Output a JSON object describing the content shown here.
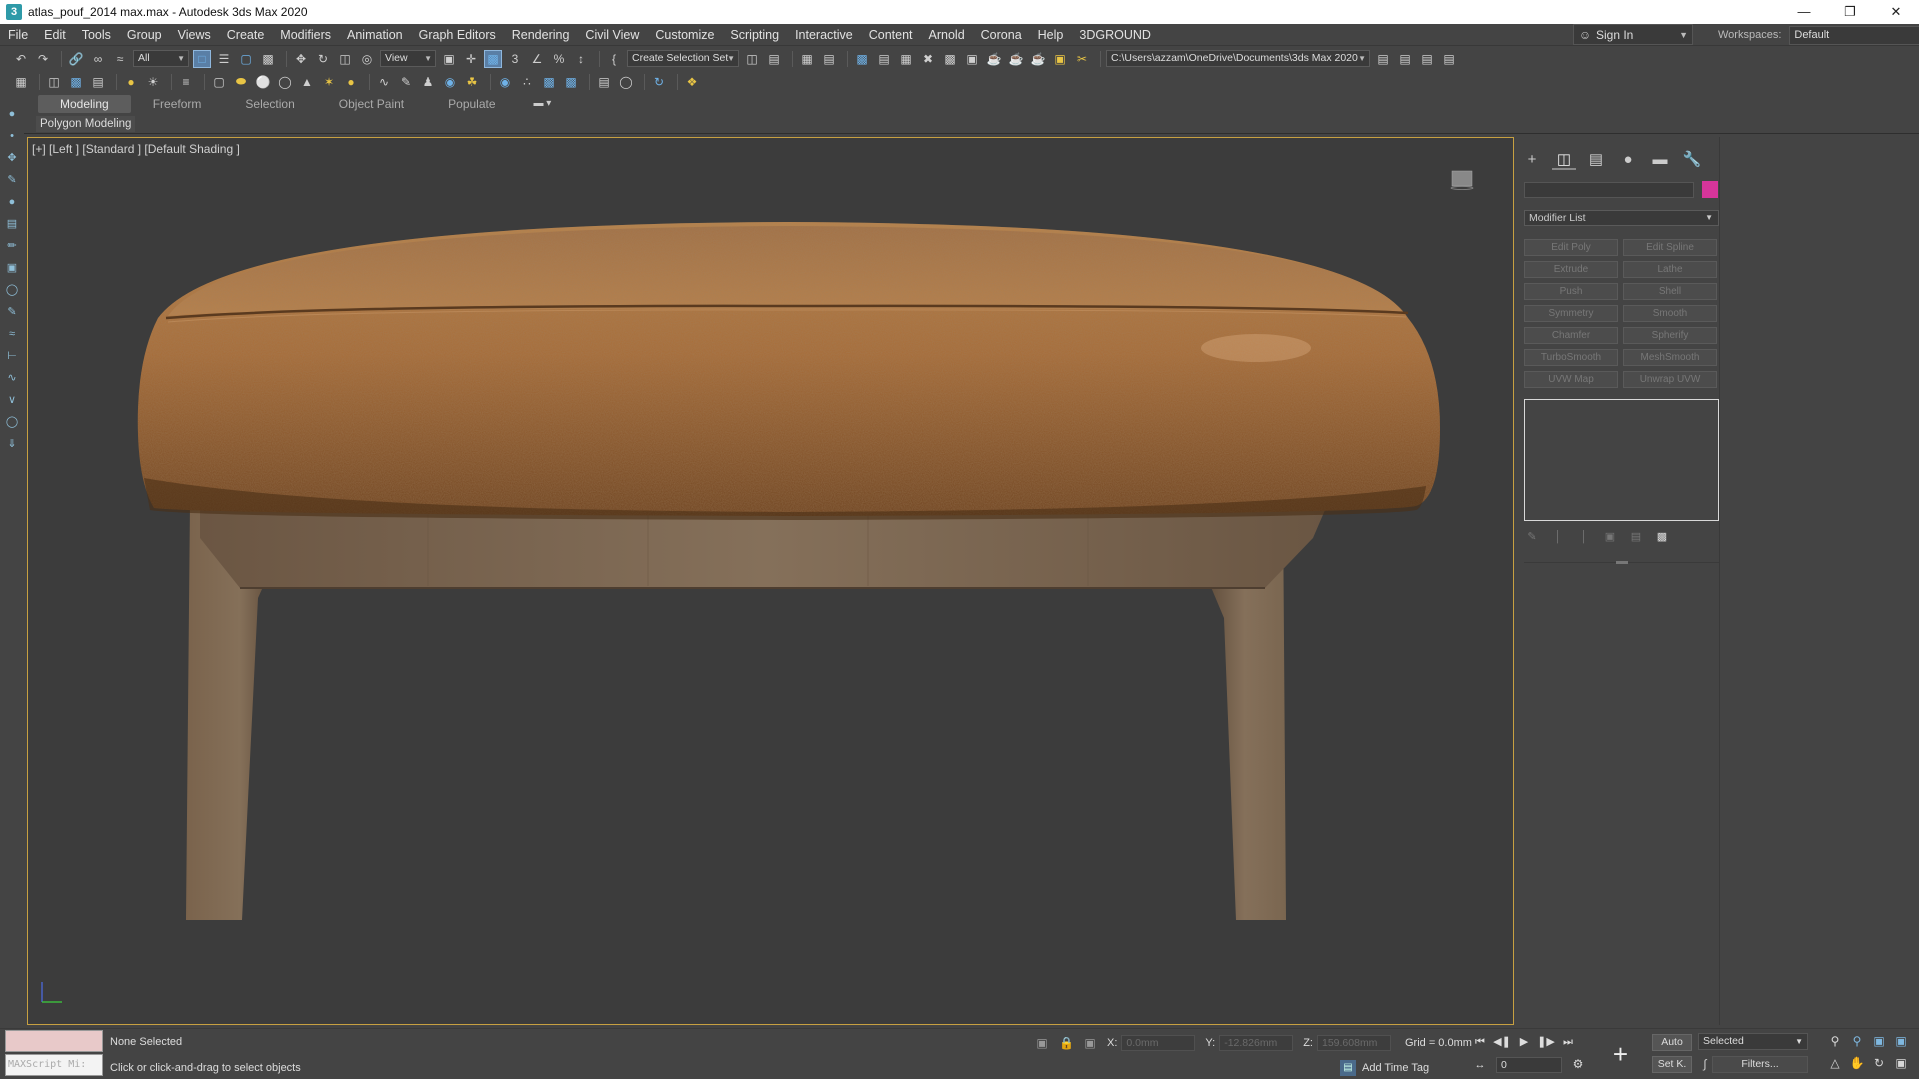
{
  "window": {
    "title": "atlas_pouf_2014 max.max - Autodesk 3ds Max 2020",
    "app_icon": "3",
    "min_glyph": "—",
    "max_glyph": "❐",
    "close_glyph": "✕"
  },
  "menu": [
    "File",
    "Edit",
    "Tools",
    "Group",
    "Views",
    "Create",
    "Modifiers",
    "Animation",
    "Graph Editors",
    "Rendering",
    "Civil View",
    "Customize",
    "Scripting",
    "Interactive",
    "Content",
    "Arnold",
    "Corona",
    "Help",
    "3DGROUND"
  ],
  "account": {
    "sign_in": "Sign In",
    "workspaces_label": "Workspaces:",
    "workspace": "Default"
  },
  "toolbar": {
    "filter": "All",
    "ref_coord": "View",
    "selection_set": "Create Selection Set",
    "project_path": "C:\\Users\\azzam\\OneDrive\\Documents\\3ds Max 2020",
    "snap_value": "3",
    "percent_glyph": "%"
  },
  "ribbon": {
    "tabs": [
      "Modeling",
      "Freeform",
      "Selection",
      "Object Paint",
      "Populate"
    ],
    "active_tab": "Modeling",
    "panel_label": "Polygon Modeling"
  },
  "viewport": {
    "label": "[+] [Left ] [Standard ] [Default Shading ]",
    "border_color": "#c7a041",
    "background": "#3c3c3c",
    "object": "pouf"
  },
  "command_panel": {
    "color_swatch": "#d6359a",
    "modifier_list": "Modifier List",
    "modifiers": [
      "Edit Poly",
      "Edit Spline",
      "Extrude",
      "Lathe",
      "Push",
      "Shell",
      "Symmetry",
      "Smooth",
      "Chamfer",
      "Spherify",
      "TurboSmooth",
      "MeshSmooth",
      "UVW Map",
      "Unwrap UVW"
    ]
  },
  "status": {
    "maxscript": "MAXScript Mi:",
    "selection": "None Selected",
    "prompt": "Click or click-and-drag to select objects",
    "x_label": "X:",
    "x_value": "0.0mm",
    "y_label": "Y:",
    "y_value": "-12.826mm",
    "z_label": "Z:",
    "z_value": "159.608mm",
    "grid": "Grid = 0.0mm",
    "add_time_tag": "Add Time Tag",
    "frame": "0",
    "auto_key": "Auto",
    "set_key": "Set K.",
    "key_mode": "Selected",
    "filters": "Filters..."
  }
}
